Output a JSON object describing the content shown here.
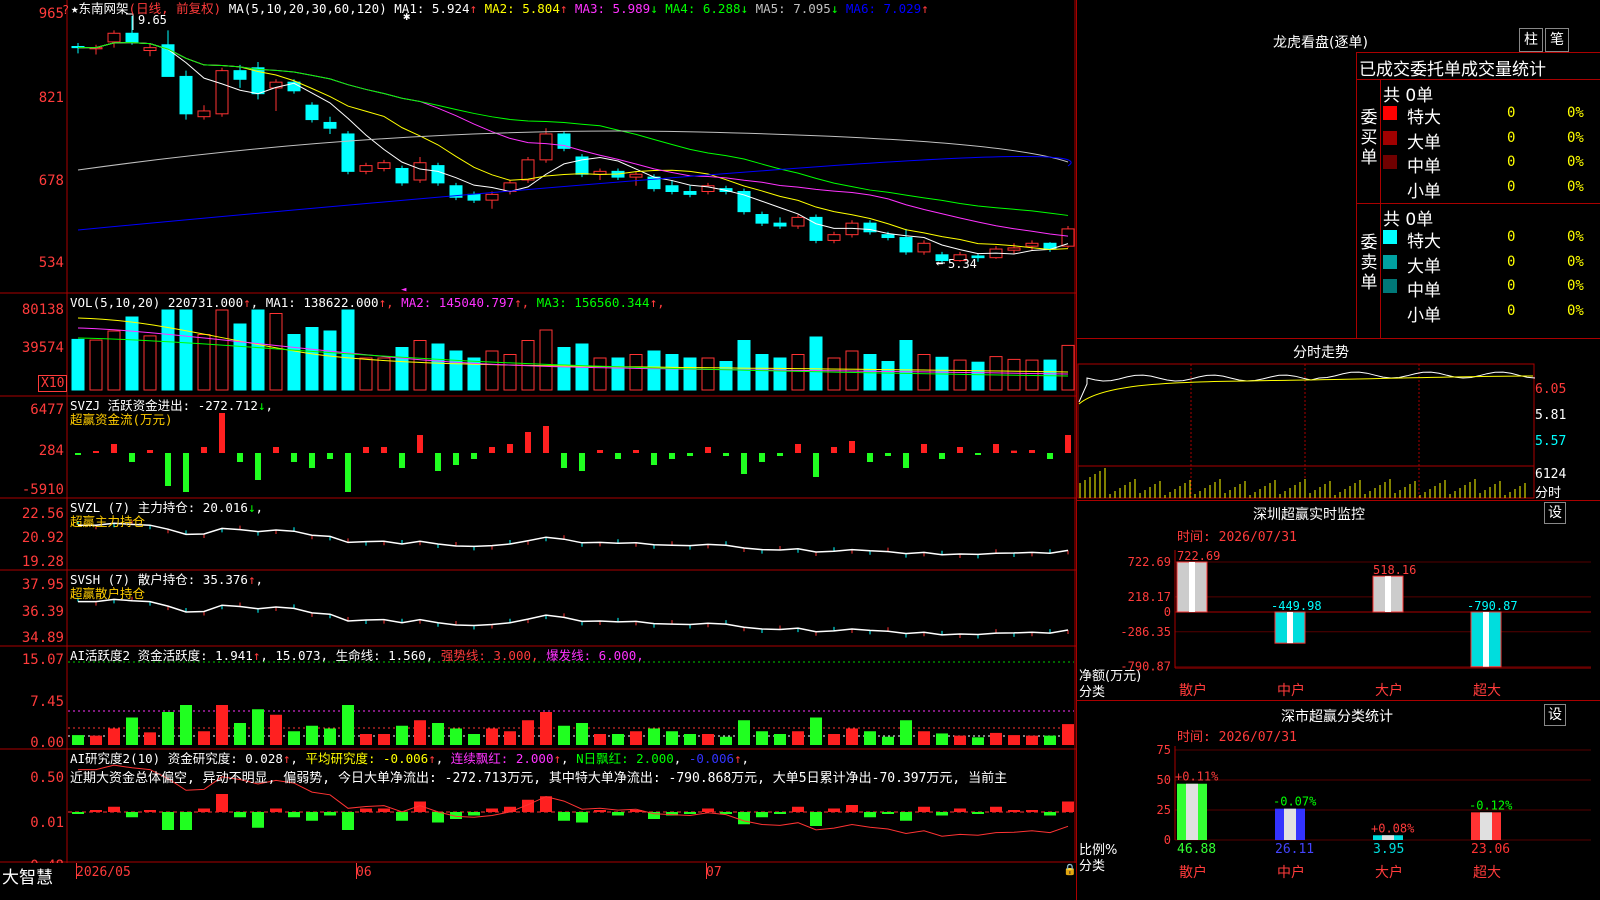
{
  "app": {
    "brand": "大智慧",
    "date_labels": [
      "2026/05",
      "06",
      "07"
    ]
  },
  "main_chart": {
    "title": "东南网架",
    "mode": "(日线, 前复权)",
    "ma_def": "MA(5,10,20,30,60,120)",
    "ma": [
      {
        "label": "MA1:",
        "value": "5.924",
        "arrow": "↑",
        "color": "#ffffff"
      },
      {
        "label": "MA2:",
        "value": "5.804",
        "arrow": "↑",
        "color": "#ffff00"
      },
      {
        "label": "MA3:",
        "value": "5.989",
        "arrow": "↓",
        "color": "#ff33ff"
      },
      {
        "label": "MA4:",
        "value": "6.288",
        "arrow": "↓",
        "color": "#00ff00"
      },
      {
        "label": "MA5:",
        "value": "7.095",
        "arrow": "↓",
        "color": "#c0c0c0"
      },
      {
        "label": "MA6:",
        "value": "7.029",
        "arrow": "↑",
        "color": "#0000ff"
      }
    ],
    "y_ticks": [
      "965",
      "821",
      "678",
      "534"
    ],
    "high_label": "9.65",
    "low_label": "5.34"
  },
  "volume": {
    "def": "VOL(5,10,20)",
    "value": "220731.000",
    "ma": [
      {
        "label": "MA1:",
        "value": "138622.000",
        "arrow": "↑",
        "color": "#ffffff"
      },
      {
        "label": "MA2:",
        "value": "145040.797",
        "arrow": "↑",
        "color": "#ff33ff"
      },
      {
        "label": "MA3:",
        "value": "156560.344",
        "arrow": "↑",
        "color": "#00ff00"
      }
    ],
    "y_ticks": [
      "80138",
      "39574"
    ],
    "unit": "X10"
  },
  "svzj": {
    "label": "SVZJ  活跃资金进出:",
    "value": "-272.712",
    "arrow": "↓",
    "sub": "超赢资金流(万元)",
    "y_ticks": [
      "6477",
      "284",
      "-5910"
    ]
  },
  "svzl": {
    "label": "SVZL (7) 主力持仓:",
    "value": "20.016",
    "arrow": "↓",
    "sub": "超赢主力持仓",
    "y_ticks": [
      "22.56",
      "20.92",
      "19.28"
    ]
  },
  "svsh": {
    "label": "SVSH (7) 散户持仓:",
    "value": "35.376",
    "arrow": "↑",
    "sub": "超赢散户持仓",
    "y_ticks": [
      "37.95",
      "36.39",
      "34.89"
    ]
  },
  "ai_active": {
    "parts": [
      {
        "text": "AI活跃度2 资金活跃度: 1.941",
        "color": "#ffffff"
      },
      {
        "text": "↑",
        "color": "#ff3b3b"
      },
      {
        "text": ", 15.073, 生命线: 1.560, ",
        "color": "#ffffff"
      },
      {
        "text": "强势线: 3.000, ",
        "color": "#ff3b3b"
      },
      {
        "text": "爆发线: 6.000,",
        "color": "#ff33ff"
      }
    ],
    "y_ticks": [
      "15.07",
      "7.45",
      "0.00"
    ]
  },
  "ai_research": {
    "parts": [
      {
        "text": "AI研究度2(10) 资金研究度: 0.028",
        "color": "#ffffff"
      },
      {
        "text": "↑",
        "color": "#ff3b3b"
      },
      {
        "text": ", ",
        "color": "#ffffff"
      },
      {
        "text": "平均研究度: -0.006",
        "color": "#ffff00"
      },
      {
        "text": "↑",
        "color": "#ff3b3b"
      },
      {
        "text": ", ",
        "color": "#ffffff"
      },
      {
        "text": "连续飘红: 2.000",
        "color": "#ff33ff"
      },
      {
        "text": "↑",
        "color": "#ff3b3b"
      },
      {
        "text": ", ",
        "color": "#ffffff"
      },
      {
        "text": "N日飘红: 2.000",
        "color": "#00ff00"
      },
      {
        "text": ", ",
        "color": "#ffffff"
      },
      {
        "text": "-0.006",
        "color": "#3333ff"
      },
      {
        "text": "↑",
        "color": "#ff3b3b"
      },
      {
        "text": ",",
        "color": "#ffffff"
      }
    ],
    "comment": "近期大资金总体偏空, 异动不明显, 偏弱势, 今日大单净流出: -272.713万元, 其中特大单净流出: -790.868万元, 大单5日累计净出-70.397万元, 当前主",
    "y_ticks": [
      "0.50",
      "0.01",
      "-0.48"
    ]
  },
  "lhb": {
    "title": "龙虎看盘(逐单)",
    "btn_bar": "柱",
    "btn_stroke": "笔",
    "subtitle": "已成交委托单成交量统计",
    "buy_label": "委买单",
    "sell_label": "委卖单",
    "buy_total": "共 0单",
    "sell_total": "共 0单",
    "buy_rows": [
      {
        "name": "特大",
        "count": "0",
        "pct": "0%",
        "color": "#ff0000"
      },
      {
        "name": "大单",
        "count": "0",
        "pct": "0%",
        "color": "#a00000"
      },
      {
        "name": "中单",
        "count": "0",
        "pct": "0%",
        "color": "#700000"
      },
      {
        "name": "小单",
        "count": "0",
        "pct": "0%",
        "color": ""
      }
    ],
    "sell_rows": [
      {
        "name": "特大",
        "count": "0",
        "pct": "0%",
        "color": "#00ffff"
      },
      {
        "name": "大单",
        "count": "0",
        "pct": "0%",
        "color": "#00a0a0"
      },
      {
        "name": "中单",
        "count": "0",
        "pct": "0%",
        "color": "#007878"
      },
      {
        "name": "小单",
        "count": "0",
        "pct": "0%",
        "color": ""
      }
    ]
  },
  "intraday": {
    "title": "分时走势",
    "y_ticks": [
      "6.05",
      "5.81",
      "5.57"
    ],
    "vol_label": "6124",
    "vol_sub": "分时"
  },
  "realtime": {
    "title": "深圳超赢实时监控",
    "setting": "设",
    "time_label": "时间: 2026/07/31",
    "y_ticks": [
      "722.69",
      "218.17",
      "0",
      "-286.35",
      "-790.87"
    ],
    "bars": [
      {
        "name": "散户",
        "value": 722.69,
        "value_label": "722.69"
      },
      {
        "name": "中户",
        "value": -449.98,
        "value_label": "-449.98"
      },
      {
        "name": "大户",
        "value": 518.16,
        "value_label": "518.16"
      },
      {
        "name": "超大",
        "value": -790.87,
        "value_label": "-790.87"
      }
    ],
    "axis_title": "净额(万元)",
    "cat_title": "分类"
  },
  "classify": {
    "title": "深市超赢分类统计",
    "setting": "设",
    "time_label": "时间: 2026/07/31",
    "y_ticks": [
      "75",
      "50",
      "25",
      "0"
    ],
    "bars": [
      {
        "name": "散户",
        "value": 46.88,
        "value_label": "46.88",
        "change": "+0.11%",
        "color": "#33ff33"
      },
      {
        "name": "中户",
        "value": 26.11,
        "value_label": "26.11",
        "change": "-0.07%",
        "color": "#3333ff"
      },
      {
        "name": "大户",
        "value": 3.95,
        "value_label": "3.95",
        "change": "+0.08%",
        "color": "#00dddd"
      },
      {
        "name": "超大",
        "value": 23.06,
        "value_label": "23.06",
        "change": "-0.12%",
        "color": "#ff3333"
      }
    ],
    "axis_title": "比例%",
    "cat_title": "分类"
  },
  "chart_data": {
    "type": "candlestick",
    "title": "东南网架",
    "series": [
      {
        "name": "OHLC",
        "points": [
          [
            9.12,
            9.18,
            9.0,
            9.1
          ],
          [
            9.08,
            9.15,
            8.98,
            9.1
          ],
          [
            9.2,
            9.4,
            9.1,
            9.35
          ],
          [
            9.35,
            9.65,
            9.15,
            9.2
          ],
          [
            9.05,
            9.18,
            8.95,
            9.1
          ],
          [
            9.15,
            9.4,
            8.8,
            8.6
          ],
          [
            8.6,
            8.7,
            7.85,
            7.95
          ],
          [
            7.9,
            8.1,
            7.85,
            8.0
          ],
          [
            7.95,
            8.75,
            7.9,
            8.7
          ],
          [
            8.7,
            8.8,
            8.4,
            8.55
          ],
          [
            8.75,
            8.85,
            8.2,
            8.3
          ],
          [
            8.4,
            8.55,
            8.0,
            8.5
          ],
          [
            8.5,
            8.55,
            8.3,
            8.35
          ],
          [
            8.1,
            8.15,
            7.8,
            7.85
          ],
          [
            7.8,
            7.9,
            7.6,
            7.7
          ],
          [
            7.6,
            7.65,
            6.9,
            6.95
          ],
          [
            6.95,
            7.1,
            6.9,
            7.05
          ],
          [
            7.0,
            7.15,
            6.95,
            7.1
          ],
          [
            7.0,
            7.05,
            6.7,
            6.75
          ],
          [
            6.8,
            7.2,
            6.75,
            7.1
          ],
          [
            7.05,
            7.1,
            6.7,
            6.75
          ],
          [
            6.7,
            6.75,
            6.45,
            6.5
          ],
          [
            6.55,
            6.6,
            6.4,
            6.45
          ],
          [
            6.45,
            6.6,
            6.3,
            6.55
          ],
          [
            6.6,
            6.8,
            6.55,
            6.75
          ],
          [
            6.8,
            7.2,
            6.75,
            7.15
          ],
          [
            7.15,
            7.7,
            7.1,
            7.6
          ],
          [
            7.6,
            7.65,
            7.3,
            7.35
          ],
          [
            7.2,
            7.25,
            6.85,
            6.9
          ],
          [
            6.9,
            7.0,
            6.8,
            6.95
          ],
          [
            6.95,
            7.0,
            6.8,
            6.85
          ],
          [
            6.85,
            6.95,
            6.7,
            6.9
          ],
          [
            6.85,
            6.9,
            6.6,
            6.65
          ],
          [
            6.7,
            6.8,
            6.55,
            6.6
          ],
          [
            6.6,
            6.7,
            6.5,
            6.55
          ],
          [
            6.6,
            6.75,
            6.55,
            6.7
          ],
          [
            6.65,
            6.7,
            6.55,
            6.6
          ],
          [
            6.6,
            6.65,
            6.2,
            6.25
          ],
          [
            6.2,
            6.25,
            6.0,
            6.05
          ],
          [
            6.05,
            6.15,
            5.95,
            6.0
          ],
          [
            6.0,
            6.2,
            5.95,
            6.15
          ],
          [
            6.15,
            6.2,
            5.7,
            5.75
          ],
          [
            5.75,
            5.9,
            5.7,
            5.85
          ],
          [
            5.85,
            6.1,
            5.8,
            6.05
          ],
          [
            6.05,
            6.1,
            5.85,
            5.9
          ],
          [
            5.85,
            5.9,
            5.75,
            5.8
          ],
          [
            5.8,
            5.95,
            5.5,
            5.55
          ],
          [
            5.55,
            5.75,
            5.5,
            5.7
          ],
          [
            5.5,
            5.55,
            5.34,
            5.4
          ],
          [
            5.4,
            5.55,
            5.38,
            5.5
          ],
          [
            5.48,
            5.52,
            5.38,
            5.45
          ],
          [
            5.45,
            5.65,
            5.43,
            5.6
          ],
          [
            5.58,
            5.7,
            5.52,
            5.62
          ],
          [
            5.65,
            5.75,
            5.58,
            5.7
          ],
          [
            5.7,
            5.72,
            5.55,
            5.6
          ],
          [
            5.65,
            6.0,
            5.62,
            5.95
          ]
        ]
      }
    ],
    "ylim": [
      5.34,
      9.65
    ]
  }
}
